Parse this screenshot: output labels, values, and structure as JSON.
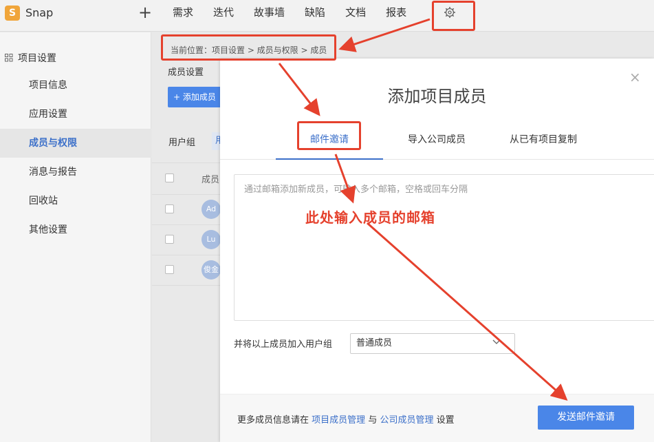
{
  "app": {
    "logo_letter": "S",
    "name": "Snap",
    "plus": "+"
  },
  "nav": [
    "需求",
    "迭代",
    "故事墙",
    "缺陷",
    "文档",
    "报表"
  ],
  "sidebar": {
    "header": "项目设置",
    "items": [
      {
        "label": "项目信息",
        "active": false
      },
      {
        "label": "应用设置",
        "active": false
      },
      {
        "label": "成员与权限",
        "active": true
      },
      {
        "label": "消息与报告",
        "active": false
      },
      {
        "label": "回收站",
        "active": false
      },
      {
        "label": "其他设置",
        "active": false
      }
    ]
  },
  "breadcrumb": "当前位置：项目设置 > 成员与权限 > 成员",
  "page": {
    "subtitle": "成员设置",
    "add_member": "+ 添加成员",
    "usergroup_label": "用户组",
    "usergroup_tab_partial": "用",
    "member_col": "成员",
    "avatars": [
      "Ad",
      "Lu",
      "俊金"
    ]
  },
  "modal": {
    "close": "×",
    "title": "添加项目成员",
    "tabs": [
      "邮件邀请",
      "导入公司成员",
      "从已有项目复制"
    ],
    "active_tab": 0,
    "email_placeholder": "通过邮箱添加新成员，可输入多个邮箱，空格或回车分隔",
    "group_label": "并将以上成员加入用户组",
    "group_value": "普通成员",
    "footer_prefix": "更多成员信息请在",
    "footer_link1": "项目成员管理",
    "footer_and": "与",
    "footer_link2": "公司成员管理",
    "footer_suffix": "设置",
    "send_button": "发送邮件邀请"
  },
  "annotation": {
    "text": "此处输入成员的邮箱",
    "color": "#e5412d"
  },
  "colors": {
    "accent": "#3b6fc9",
    "button": "#4a86e8",
    "logo": "#f0a53a"
  }
}
